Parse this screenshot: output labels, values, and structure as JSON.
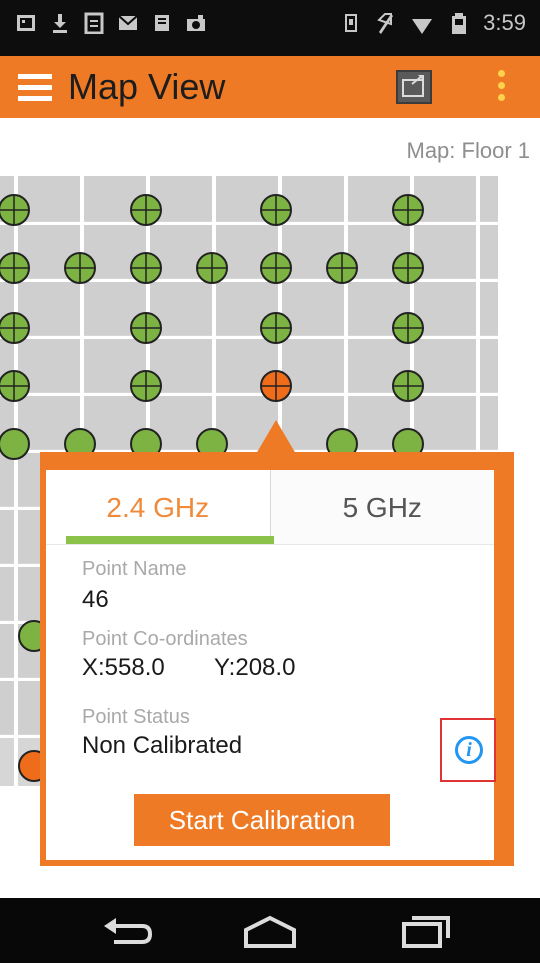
{
  "status_bar": {
    "time": "3:59",
    "left_icons": [
      "gallery-icon",
      "download-icon",
      "clipboard-icon",
      "email-icon",
      "notification-icon",
      "photo-icon"
    ],
    "right_icons": [
      "vibrate-icon",
      "no-sim-icon",
      "wifi-icon",
      "battery-icon"
    ]
  },
  "action_bar": {
    "title": "Map View",
    "menu_icon": "hamburger-menu-icon",
    "map_button_icon": "map-overlay-icon",
    "overflow_icon": "overflow-menu-icon"
  },
  "map": {
    "label": "Map: Floor 1",
    "points": [
      {
        "row": 0,
        "col": 0,
        "status": "calibrated"
      },
      {
        "row": 0,
        "col": 2,
        "status": "calibrated"
      },
      {
        "row": 0,
        "col": 4,
        "status": "calibrated"
      },
      {
        "row": 0,
        "col": 6,
        "status": "calibrated"
      },
      {
        "row": 1,
        "col": 0,
        "status": "calibrated"
      },
      {
        "row": 1,
        "col": 1,
        "status": "calibrated"
      },
      {
        "row": 1,
        "col": 2,
        "status": "calibrated"
      },
      {
        "row": 1,
        "col": 3,
        "status": "calibrated"
      },
      {
        "row": 1,
        "col": 4,
        "status": "calibrated"
      },
      {
        "row": 1,
        "col": 5,
        "status": "calibrated"
      },
      {
        "row": 1,
        "col": 6,
        "status": "calibrated"
      },
      {
        "row": 2,
        "col": 0,
        "status": "calibrated"
      },
      {
        "row": 2,
        "col": 2,
        "status": "calibrated"
      },
      {
        "row": 2,
        "col": 4,
        "status": "calibrated"
      },
      {
        "row": 2,
        "col": 6,
        "status": "calibrated"
      },
      {
        "row": 3,
        "col": 0,
        "status": "calibrated"
      },
      {
        "row": 3,
        "col": 2,
        "status": "calibrated"
      },
      {
        "row": 3,
        "col": 4,
        "status": "selected"
      },
      {
        "row": 3,
        "col": 6,
        "status": "calibrated"
      }
    ],
    "colors": {
      "calibrated": "#7cb342",
      "selected": "#ef6c1a",
      "grid_tile": "#cfcfcf",
      "grid_line": "#ffffff"
    }
  },
  "popup": {
    "tabs": [
      {
        "label": "2.4 GHz",
        "active": true
      },
      {
        "label": "5 GHz",
        "active": false
      }
    ],
    "point_name_label": "Point Name",
    "point_name_value": "46",
    "coords_label": "Point Co-ordinates",
    "x_value": "X:558.0",
    "y_value": "Y:208.0",
    "status_label": "Point Status",
    "status_value": "Non Calibrated",
    "info_icon": "info-icon",
    "start_button": "Start Calibration"
  },
  "nav_bar": {
    "back_icon": "back-icon",
    "home_icon": "home-icon",
    "recents_icon": "recents-icon"
  },
  "colors": {
    "accent": "#ef7a25",
    "active_tab_text": "#ef8a3a",
    "tab_indicator": "#8bc34a",
    "info_blue": "#2196f3",
    "highlight_red": "#e03434"
  }
}
